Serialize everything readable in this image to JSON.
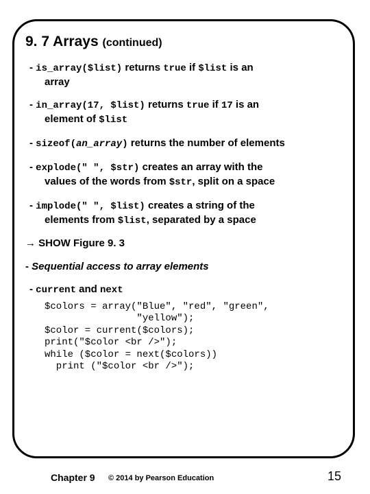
{
  "title": {
    "num": "9. 7",
    "text": "Arrays",
    "cont": "(continued)"
  },
  "b1": {
    "code": "is_array($list)",
    "mid": " returns ",
    "code2": "true",
    "post": " if ",
    "code3": "$list",
    "post2": " is an",
    "line2": "array"
  },
  "b2": {
    "code": "in_array(17, $list)",
    "mid": " returns ",
    "code2": "true",
    "post": " if ",
    "code3": "17",
    "post2": " is an",
    "line2_a": "element of ",
    "line2_code": "$list"
  },
  "b3": {
    "code": "sizeof(",
    "ital": "an_array",
    "code_close": ")",
    "post": " returns the number of elements"
  },
  "b4": {
    "code": "explode(\" \", $str)",
    "post": " creates an array with the",
    "line2_a": "values of the words from ",
    "line2_code": "$str",
    "line2_b": ", split on a space"
  },
  "b5": {
    "code": "implode(\" \", $list)",
    "post": " creates a string of the",
    "line2_a": "elements from ",
    "line2_code": "$list",
    "line2_b": ", separated by a space"
  },
  "show": {
    "arrow": "→",
    "text": " SHOW Figure 9. 3"
  },
  "seq": {
    "text": "Sequential access to array elements"
  },
  "cn": {
    "c1": "current",
    "and": " and ",
    "c2": "next"
  },
  "code": "$colors = array(\"Blue\", \"red\", \"green\",\n                \"yellow\");\n$color = current($colors);\nprint(\"$color <br />\");\nwhile ($color = next($colors))\n  print (\"$color <br />\");",
  "footer": {
    "chapter": "Chapter 9",
    "copy": "© 2014 by Pearson Education",
    "page": "15"
  }
}
